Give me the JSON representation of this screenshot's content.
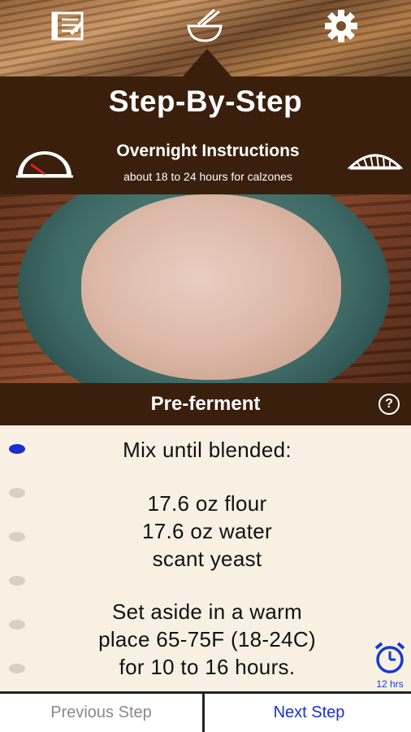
{
  "tabs": [
    {
      "name": "notes",
      "icon": "notes-clipboard-icon"
    },
    {
      "name": "mix",
      "icon": "mixing-bowl-icon"
    },
    {
      "name": "settings",
      "icon": "gear-icon"
    }
  ],
  "header": {
    "title": "Step-By-Step",
    "subtitle": "Overnight Instructions",
    "note": "about 18 to 24 hours for calzones"
  },
  "section": {
    "title": "Pre-ferment",
    "help_symbol": "?"
  },
  "instructions": {
    "lines": [
      "Mix until blended:",
      "17.6 oz flour",
      "17.6 oz water",
      "scant yeast",
      "Set aside in a warm",
      "place 65-75F (18-24C)",
      "for 10 to 16 hours."
    ],
    "step_dots": 6,
    "active_step": 0
  },
  "timer": {
    "label": "12 hrs",
    "icon": "alarm-clock-icon"
  },
  "buttons": {
    "previous": "Previous Step",
    "next": "Next Step"
  },
  "colors": {
    "header_bg": "#3a1f0d",
    "accent": "#1a2fd0",
    "content_bg": "#f8f1e3"
  }
}
